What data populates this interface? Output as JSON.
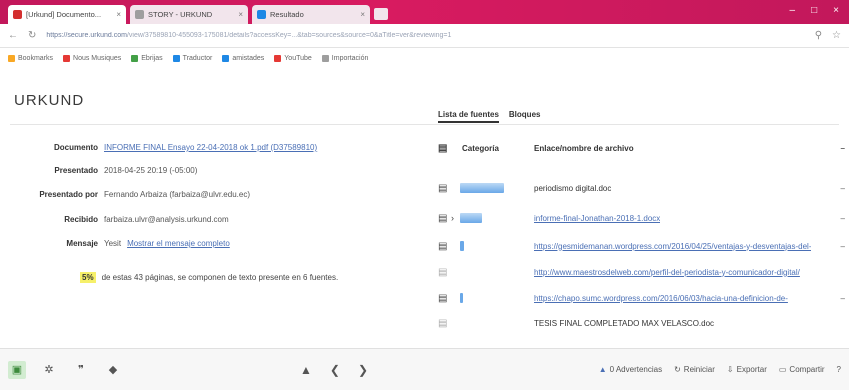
{
  "colors": {
    "chrome": "#c2185b",
    "accent_link": "#4a6fb5",
    "highlight": "#f6f06a",
    "bar_blue": "#6aa8e8",
    "active_green": "#d2ecd1"
  },
  "browser": {
    "tabs": [
      {
        "label": "[Urkund] Documento...",
        "color": "#d32f2f"
      },
      {
        "label": "STORY - URKUND",
        "color": "#9e9e9e"
      },
      {
        "label": "Resultado",
        "color": "#1e88e5"
      }
    ],
    "url": {
      "host": "https://secure.urkund.com",
      "path": "/view/37589810-455093-175081/details?accessKey=...&tab=sources&source=0&aTitle=ver&reviewing=1"
    },
    "bookmarks": [
      {
        "label": "Bookmarks",
        "color": "#f9a825"
      },
      {
        "label": "Nous Musiques",
        "color": "#e53935"
      },
      {
        "label": "Ebrijas",
        "color": "#43a047"
      },
      {
        "label": "Traductor",
        "color": "#1e88e5"
      },
      {
        "label": "amistades",
        "color": "#1e88e5"
      },
      {
        "label": "YouTube",
        "color": "#e53935"
      },
      {
        "label": "Importación",
        "color": "#9e9e9e"
      }
    ]
  },
  "app": {
    "logo": "URKUND",
    "details": {
      "documento_label": "Documento",
      "documento_value": "INFORME FINAL Ensayo 22-04-2018 ok 1.pdf (D37589810)",
      "presentado_label": "Presentado",
      "presentado_value": "2018-04-25 20:19 (-05:00)",
      "presentado_por_label": "Presentado por",
      "presentado_por_value": "Fernando Arbaiza (farbaiza@ulvr.edu.ec)",
      "recibido_label": "Recibido",
      "recibido_value": "farbaiza.ulvr@analysis.urkund.com",
      "mensaje_label": "Mensaje",
      "mensaje_value": "Yesit",
      "mensaje_link": "Mostrar el mensaje completo",
      "summary_pct": "5%",
      "summary_text": "de estas 43 páginas, se componen de texto presente en 6 fuentes."
    },
    "right_tabs": [
      "Lista de fuentes",
      "Bloques"
    ],
    "sources_header": {
      "category": "Categoría",
      "link": "Enlace/nombre de archivo"
    },
    "sources": [
      {
        "name": "periodismo digital.doc",
        "is_link": false,
        "bar_width": 44
      },
      {
        "name": "informe-final-Jonathan-2018-1.docx",
        "is_link": true,
        "bar_width": 22
      },
      {
        "name": "https://gesmidemanan.wordpress.com/2016/04/25/ventajas-y-desventajas-del-",
        "is_link": true,
        "bar_width": 4
      },
      {
        "name": "http://www.maestrosdelweb.com/perfil-del-periodista-y-comunicador-digital/",
        "is_link": true,
        "bar_width": 0
      },
      {
        "name": "https://chapo.sumc.wordpress.com/2016/06/03/hacia-una-definicion-de-",
        "is_link": true,
        "bar_width": 3
      },
      {
        "name": "TESIS FINAL COMPLETADO MAX VELASCO.doc",
        "is_link": false,
        "bar_width": 0
      }
    ]
  },
  "bottombar": {
    "actions": [
      {
        "label": "0 Advertencias",
        "icon": "warning-icon"
      },
      {
        "label": "Reiniciar",
        "icon": "reset-icon"
      },
      {
        "label": "Exportar",
        "icon": "export-icon"
      },
      {
        "label": "Compartir",
        "icon": "share-icon"
      }
    ]
  }
}
